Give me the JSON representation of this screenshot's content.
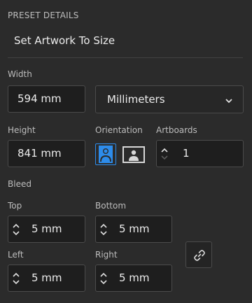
{
  "section": {
    "title": "PRESET DETAILS",
    "preset_name": "Set Artwork To Size"
  },
  "width": {
    "label": "Width",
    "value": "594 mm"
  },
  "units": {
    "selected": "Millimeters"
  },
  "height": {
    "label": "Height",
    "value": "841 mm"
  },
  "orientation": {
    "label": "Orientation",
    "selected": "portrait"
  },
  "artboards": {
    "label": "Artboards",
    "value": "1"
  },
  "bleed": {
    "label": "Bleed",
    "top": {
      "label": "Top",
      "value": "5 mm"
    },
    "bottom": {
      "label": "Bottom",
      "value": "5 mm"
    },
    "left": {
      "label": "Left",
      "value": "5 mm"
    },
    "right": {
      "label": "Right",
      "value": "5 mm"
    }
  },
  "colors": {
    "background": "#2b2b2b",
    "field_bg": "#1e1e1e",
    "accent": "#2d8ceb"
  },
  "icons": {
    "units_chevron": "chevron-down-icon",
    "portrait": "portrait-orientation-icon",
    "landscape": "landscape-orientation-icon",
    "link": "link-chain-icon"
  }
}
